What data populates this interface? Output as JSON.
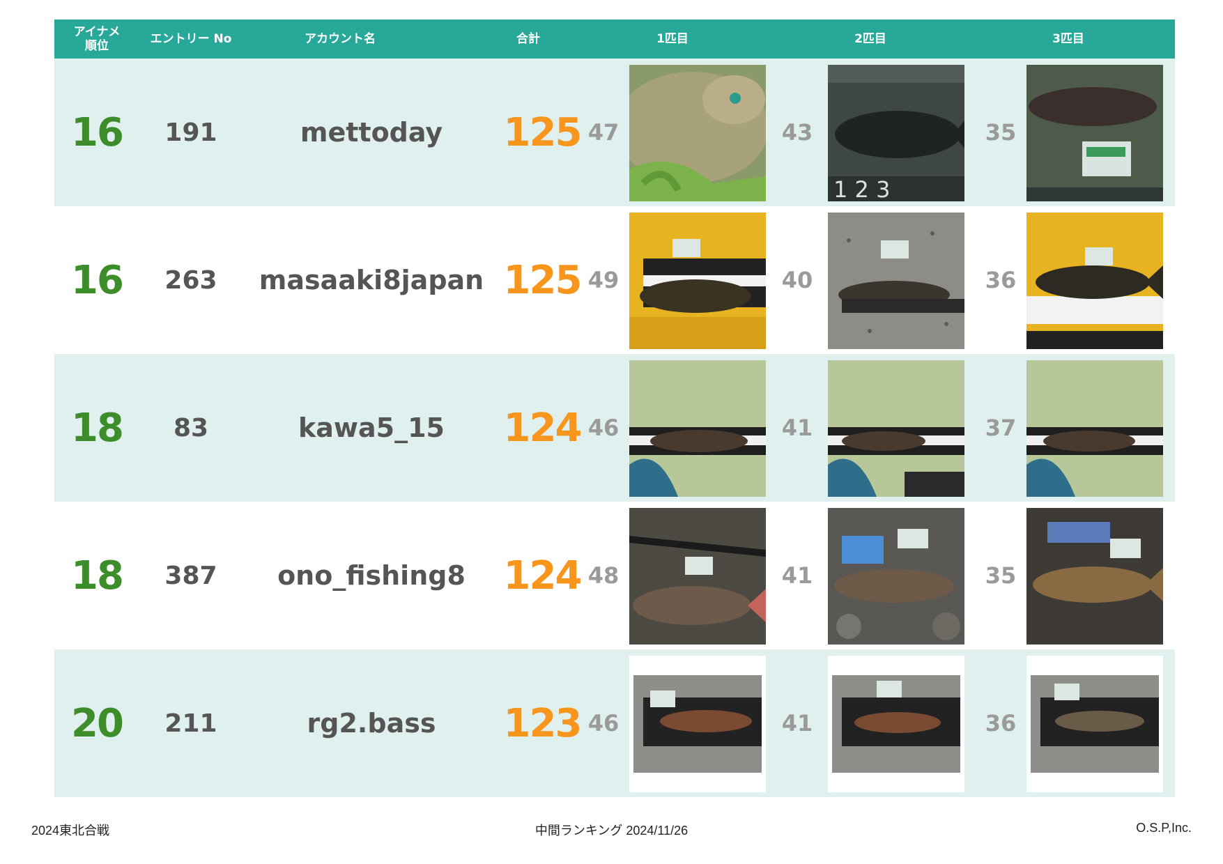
{
  "header": {
    "rank_line1": "アイナメ",
    "rank_line2": "順位",
    "entry_no": "エントリー No",
    "account": "アカウント名",
    "total": "合計",
    "fish1": "1匹目",
    "fish2": "2匹目",
    "fish3": "3匹目"
  },
  "rows": [
    {
      "rank": "16",
      "entry": "191",
      "account": "mettoday",
      "total": "125",
      "s1": "47",
      "s2": "43",
      "s3": "35"
    },
    {
      "rank": "16",
      "entry": "263",
      "account": "masaaki8japan",
      "total": "125",
      "s1": "49",
      "s2": "40",
      "s3": "36"
    },
    {
      "rank": "18",
      "entry": "83",
      "account": "kawa5_15",
      "total": "124",
      "s1": "46",
      "s2": "41",
      "s3": "37"
    },
    {
      "rank": "18",
      "entry": "387",
      "account": "ono_fishing8",
      "total": "124",
      "s1": "48",
      "s2": "41",
      "s3": "35"
    },
    {
      "rank": "20",
      "entry": "211",
      "account": "rg2.bass",
      "total": "123",
      "s1": "46",
      "s2": "41",
      "s3": "36"
    }
  ],
  "footer": {
    "left": "2024東北合戦",
    "center": "中間ランキング 2024/11/26",
    "right": "O.S.P,Inc."
  },
  "colors": {
    "header_bg": "#27a899",
    "row_alt_bg": "#dff0ef",
    "rank": "#3d8e2a",
    "total": "#f7951d",
    "size": "#9a9a9a",
    "text": "#555555"
  }
}
